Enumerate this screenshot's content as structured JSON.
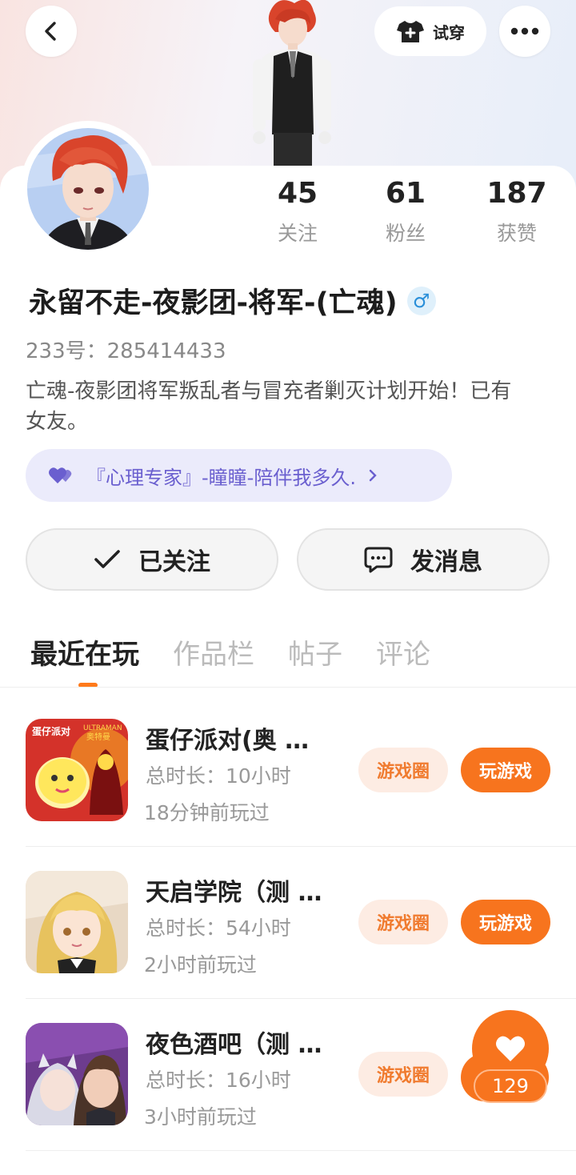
{
  "header": {
    "back_icon": "chevron-left-icon",
    "try_on_label": "试穿",
    "try_on_icon": "tshirt-plus-icon",
    "more_icon": "more-dots-icon"
  },
  "profile": {
    "stats": [
      {
        "value": "45",
        "label": "关注"
      },
      {
        "value": "61",
        "label": "粉丝"
      },
      {
        "value": "187",
        "label": "获赞"
      }
    ],
    "name": "永留不走-夜影团-将军-(亡魂)",
    "gender_symbol": "♂",
    "uid": "233号：285414433",
    "bio": "亡魂-夜影团将军叛乱者与冒充者剿灭计划开始！已有女友。",
    "tag": "『心理专家』-瞳瞳-陪伴我多久."
  },
  "actions": {
    "follow_label": "已关注",
    "message_label": "发消息"
  },
  "tabs": [
    {
      "label": "最近在玩",
      "active": true
    },
    {
      "label": "作品栏",
      "active": false
    },
    {
      "label": "帖子",
      "active": false
    },
    {
      "label": "评论",
      "active": false
    }
  ],
  "games": [
    {
      "name": "蛋仔派对(奥 …",
      "duration": "总时长：10小时",
      "last_played": "18分钟前玩过",
      "circle_label": "游戏圈",
      "play_label": "玩游戏"
    },
    {
      "name": "天启学院（测 …",
      "duration": "总时长：54小时",
      "last_played": "2小时前玩过",
      "circle_label": "游戏圈",
      "play_label": "玩游戏"
    },
    {
      "name": "夜色酒吧（测 …",
      "duration": "总时长：16小时",
      "last_played": "3小时前玩过",
      "circle_label": "游戏圈",
      "play_label": ""
    }
  ],
  "like": {
    "count": "129"
  },
  "game_icon_text": {
    "ultraman_top": "ULTRAMAN",
    "ultraman_sub": "奥特曼",
    "party": "蛋仔派对"
  },
  "colors": {
    "accent": "#f7741e",
    "tag_text": "#6a5fcf",
    "muted": "#999999"
  }
}
